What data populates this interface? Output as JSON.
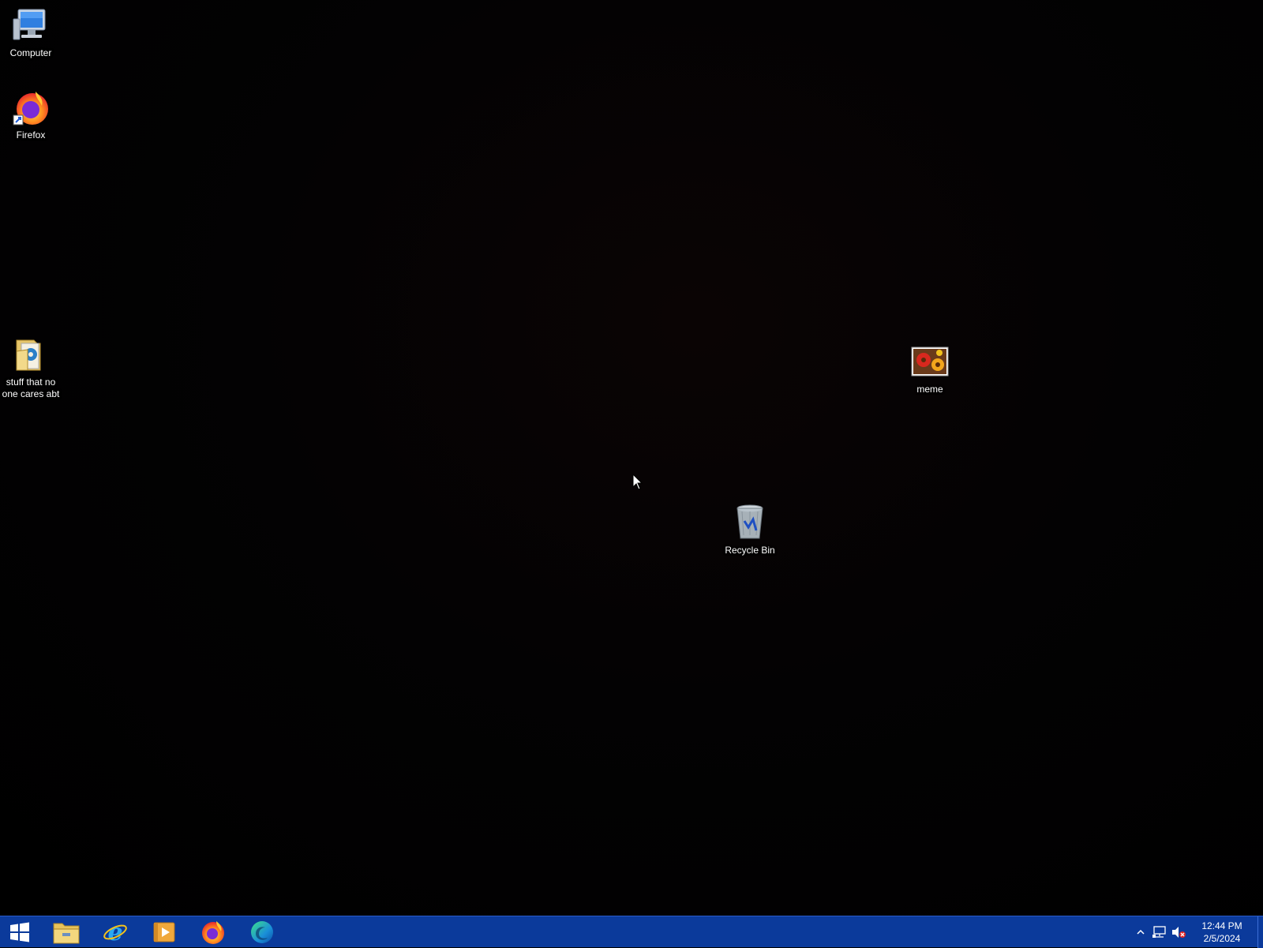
{
  "desktop": {
    "icons": [
      {
        "label": "Computer",
        "icon": "computer-icon"
      },
      {
        "label": "Firefox",
        "icon": "firefox-icon"
      },
      {
        "label": "stuff that no one cares abt",
        "icon": "folder-icon"
      },
      {
        "label": "meme",
        "icon": "image-file-icon"
      },
      {
        "label": "Recycle Bin",
        "icon": "recycle-bin-icon"
      }
    ]
  },
  "taskbar": {
    "color": "#0b3a9b",
    "pinned": [
      {
        "icon": "windows-logo-icon"
      },
      {
        "icon": "file-explorer-icon"
      },
      {
        "icon": "internet-explorer-icon"
      },
      {
        "icon": "media-player-icon"
      },
      {
        "icon": "firefox-icon"
      },
      {
        "icon": "edge-icon"
      }
    ],
    "tray": {
      "icons": [
        "chevron-up-icon",
        "network-icon",
        "volume-muted-icon"
      ],
      "time": "12:44 PM",
      "date": "2/5/2024"
    }
  }
}
